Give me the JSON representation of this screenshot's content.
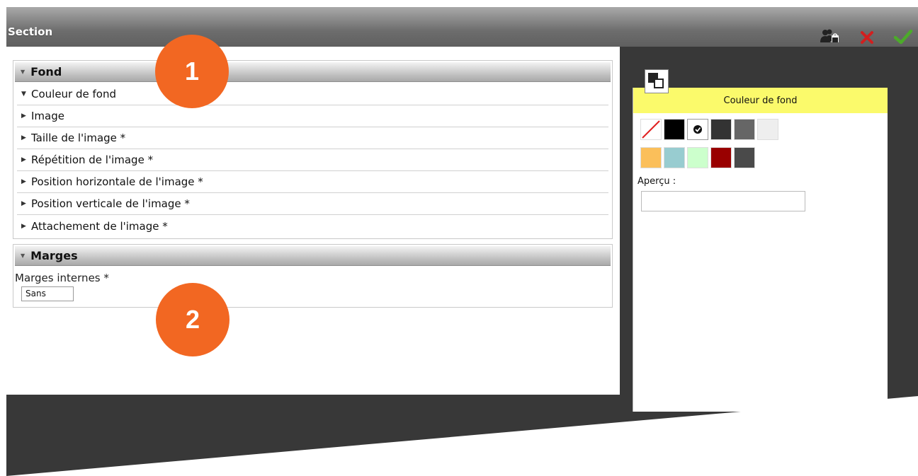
{
  "window": {
    "title": "Section"
  },
  "toolbar": {
    "users_icon": "users-lock-icon",
    "cancel_icon": "close-icon",
    "confirm_icon": "check-icon"
  },
  "fond": {
    "header": "Fond",
    "items": [
      {
        "label": "Couleur de fond",
        "state": "expanded"
      },
      {
        "label": "Image",
        "state": "collapsed"
      },
      {
        "label": "Taille de l'image *",
        "state": "collapsed"
      },
      {
        "label": "Répétition de l'image *",
        "state": "collapsed"
      },
      {
        "label": "Position horizontale de l'image *",
        "state": "collapsed"
      },
      {
        "label": "Position verticale de l'image *",
        "state": "collapsed"
      },
      {
        "label": "Attachement de l'image *",
        "state": "collapsed"
      }
    ]
  },
  "marges": {
    "header": "Marges",
    "field_label": "Marges internes *",
    "field_value": "Sans"
  },
  "badges": {
    "one": "1",
    "two": "2"
  },
  "color_panel": {
    "title": "Couleur de fond",
    "preview_label": "Aperçu :",
    "selected_index": 2,
    "swatches_row1": [
      "none",
      "#000000",
      "#ffffff",
      "#333333",
      "#666666",
      "#eeeeee"
    ],
    "swatches_row2": [
      "#fbbf5a",
      "#98ccd0",
      "#ccffcc",
      "#990000",
      "#4a4a4a"
    ]
  },
  "colors": {
    "accent": "#f26722",
    "panel_title_bg": "#fbfa6b",
    "dark_bg": "#383838"
  }
}
